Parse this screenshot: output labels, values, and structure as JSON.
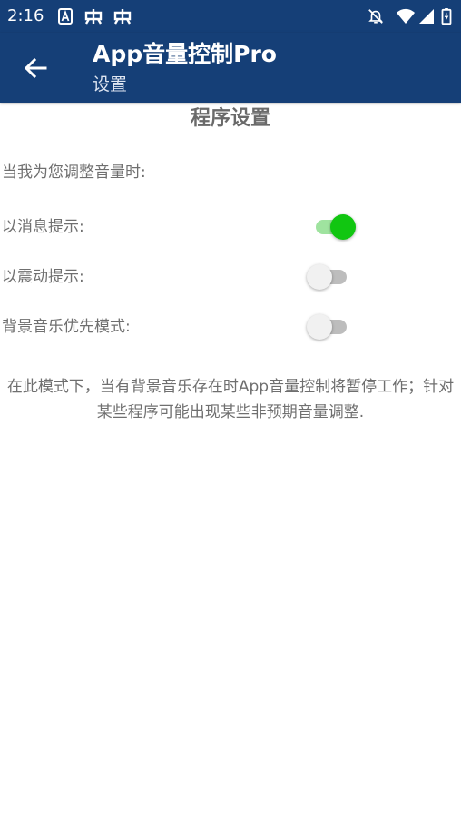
{
  "statusbar": {
    "time": "2:16",
    "left_icons": [
      "a-badge-icon",
      "bug-icon",
      "bug-icon"
    ],
    "right_icons": [
      "notifications-off-icon",
      "wifi-icon",
      "cell-signal-icon",
      "battery-charging-icon"
    ]
  },
  "appbar": {
    "title": "App音量控制Pro",
    "subtitle": "设置",
    "back_icon": "arrow-back-icon"
  },
  "content": {
    "section_title": "程序设置",
    "intro": "当我为您调整音量时:",
    "settings": [
      {
        "label": "以消息提示:",
        "enabled": true
      },
      {
        "label": "以震动提示:",
        "enabled": false
      },
      {
        "label": "背景音乐优先模式:",
        "enabled": false
      }
    ],
    "note": "在此模式下，当有背景音乐存在时App音量控制将暂停工作；针对某些程序可能出现某些非预期音量调整."
  },
  "colors": {
    "primary": "#153f77",
    "switch_on_thumb": "#11c611",
    "switch_on_track": "#9fe39f",
    "switch_off_thumb": "#f1f1f1",
    "switch_off_track": "#bdbdbd",
    "text_secondary": "#6f6f6f"
  }
}
